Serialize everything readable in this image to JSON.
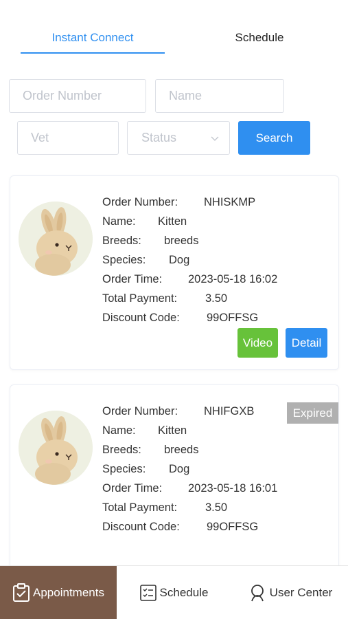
{
  "tabs": {
    "active": "Instant Connect",
    "second": "Schedule"
  },
  "filters": {
    "order_number_placeholder": "Order Number",
    "name_placeholder": "Name",
    "vet_placeholder": "Vet",
    "status_placeholder": "Status",
    "search_label": "Search"
  },
  "labels": {
    "order_number": "Order Number:",
    "name": "Name:",
    "breeds": "Breeds:",
    "species": "Species:",
    "order_time": "Order Time:",
    "total_payment": "Total Payment:",
    "discount_code": "Discount Code:"
  },
  "orders": [
    {
      "order_number": "NHISKMP",
      "name": "Kitten",
      "breeds": "breeds",
      "species": "Dog",
      "order_time": "2023-05-18 16:02",
      "total_payment": "3.50",
      "discount_code": "99OFFSG",
      "video_label": "Video",
      "detail_label": "Detail"
    },
    {
      "order_number": "NHIFGXB",
      "name": "Kitten",
      "breeds": "breeds",
      "species": "Dog",
      "order_time": "2023-05-18 16:01",
      "total_payment": "3.50",
      "discount_code": "99OFFSG",
      "status_badge": "Expired"
    }
  ],
  "bottom_nav": {
    "appointments": "Appointments",
    "schedule": "Schedule",
    "user_center": "User Center"
  },
  "colors": {
    "accent": "#2f8ff0",
    "video": "#67c23a",
    "nav_active": "#7a5a48",
    "badge": "#b0b0b0"
  },
  "icons": [
    "chevron-down-icon",
    "rabbit-avatar",
    "clipboard-check-icon",
    "checklist-icon",
    "user-icon"
  ]
}
